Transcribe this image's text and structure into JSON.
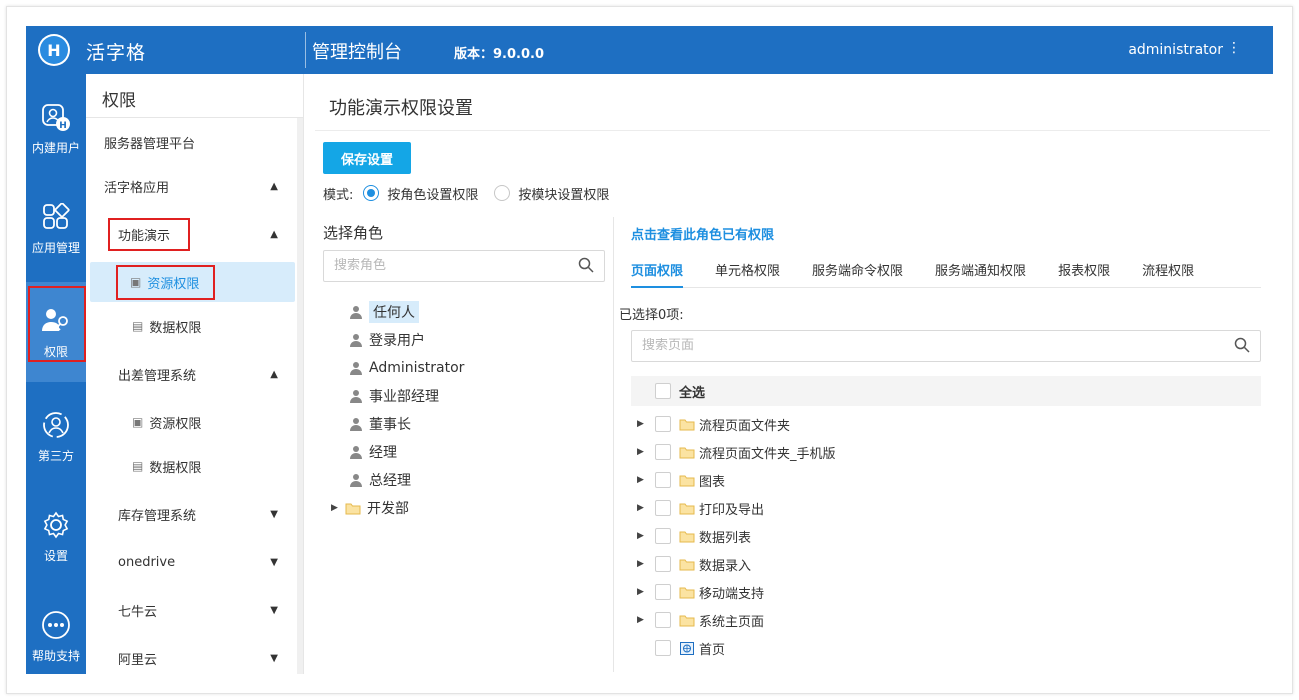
{
  "header": {
    "app_name": "活字格",
    "console_title": "管理控制台",
    "version_label": "版本：",
    "version": "9.0.0.0",
    "user": "administrator",
    "brand_color": "#1e6fc2"
  },
  "rail": {
    "items": [
      {
        "label": "内建用户",
        "icon": "user-badge-icon"
      },
      {
        "label": "应用管理",
        "icon": "apps-grid-icon"
      },
      {
        "label": "权限",
        "icon": "user-key-icon"
      },
      {
        "label": "第三方",
        "icon": "third-party-icon"
      },
      {
        "label": "设置",
        "icon": "gear-icon"
      },
      {
        "label": "帮助支持",
        "icon": "help-dots-icon"
      }
    ],
    "active": "权限"
  },
  "nav": {
    "title": "权限",
    "items": [
      {
        "label": "服务器管理平台"
      },
      {
        "label": "活字格应用"
      },
      {
        "label": "功能演示"
      },
      {
        "label": "资源权限"
      },
      {
        "label": "数据权限"
      },
      {
        "label": "出差管理系统"
      },
      {
        "label": "资源权限"
      },
      {
        "label": "数据权限"
      },
      {
        "label": "库存管理系统"
      },
      {
        "label": "onedrive"
      },
      {
        "label": "七牛云"
      },
      {
        "label": "阿里云"
      }
    ]
  },
  "main": {
    "title": "功能演示权限设置",
    "save_label": "保存设置",
    "mode_label": "模式:",
    "mode_options": [
      "按角色设置权限",
      "按模块设置权限"
    ],
    "mode_selected": "按角色设置权限"
  },
  "roles": {
    "title": "选择角色",
    "search_placeholder": "搜索角色",
    "items": [
      "任何人",
      "登录用户",
      "Administrator",
      "事业部经理",
      "董事长",
      "经理",
      "总经理"
    ],
    "folder": "开发部",
    "selected": "任何人"
  },
  "permissions": {
    "view_link": "点击查看此角色已有权限",
    "tabs": [
      "页面权限",
      "单元格权限",
      "服务端命令权限",
      "服务端通知权限",
      "报表权限",
      "流程权限"
    ],
    "active_tab": "页面权限",
    "selected_count": "已选择0项:",
    "search_placeholder": "搜索页面",
    "select_all": "全选",
    "folders": [
      "流程页面文件夹",
      "流程页面文件夹_手机版",
      "图表",
      "打印及导出",
      "数据列表",
      "数据录入",
      "移动端支持",
      "系统主页面"
    ],
    "home_page": "首页"
  }
}
